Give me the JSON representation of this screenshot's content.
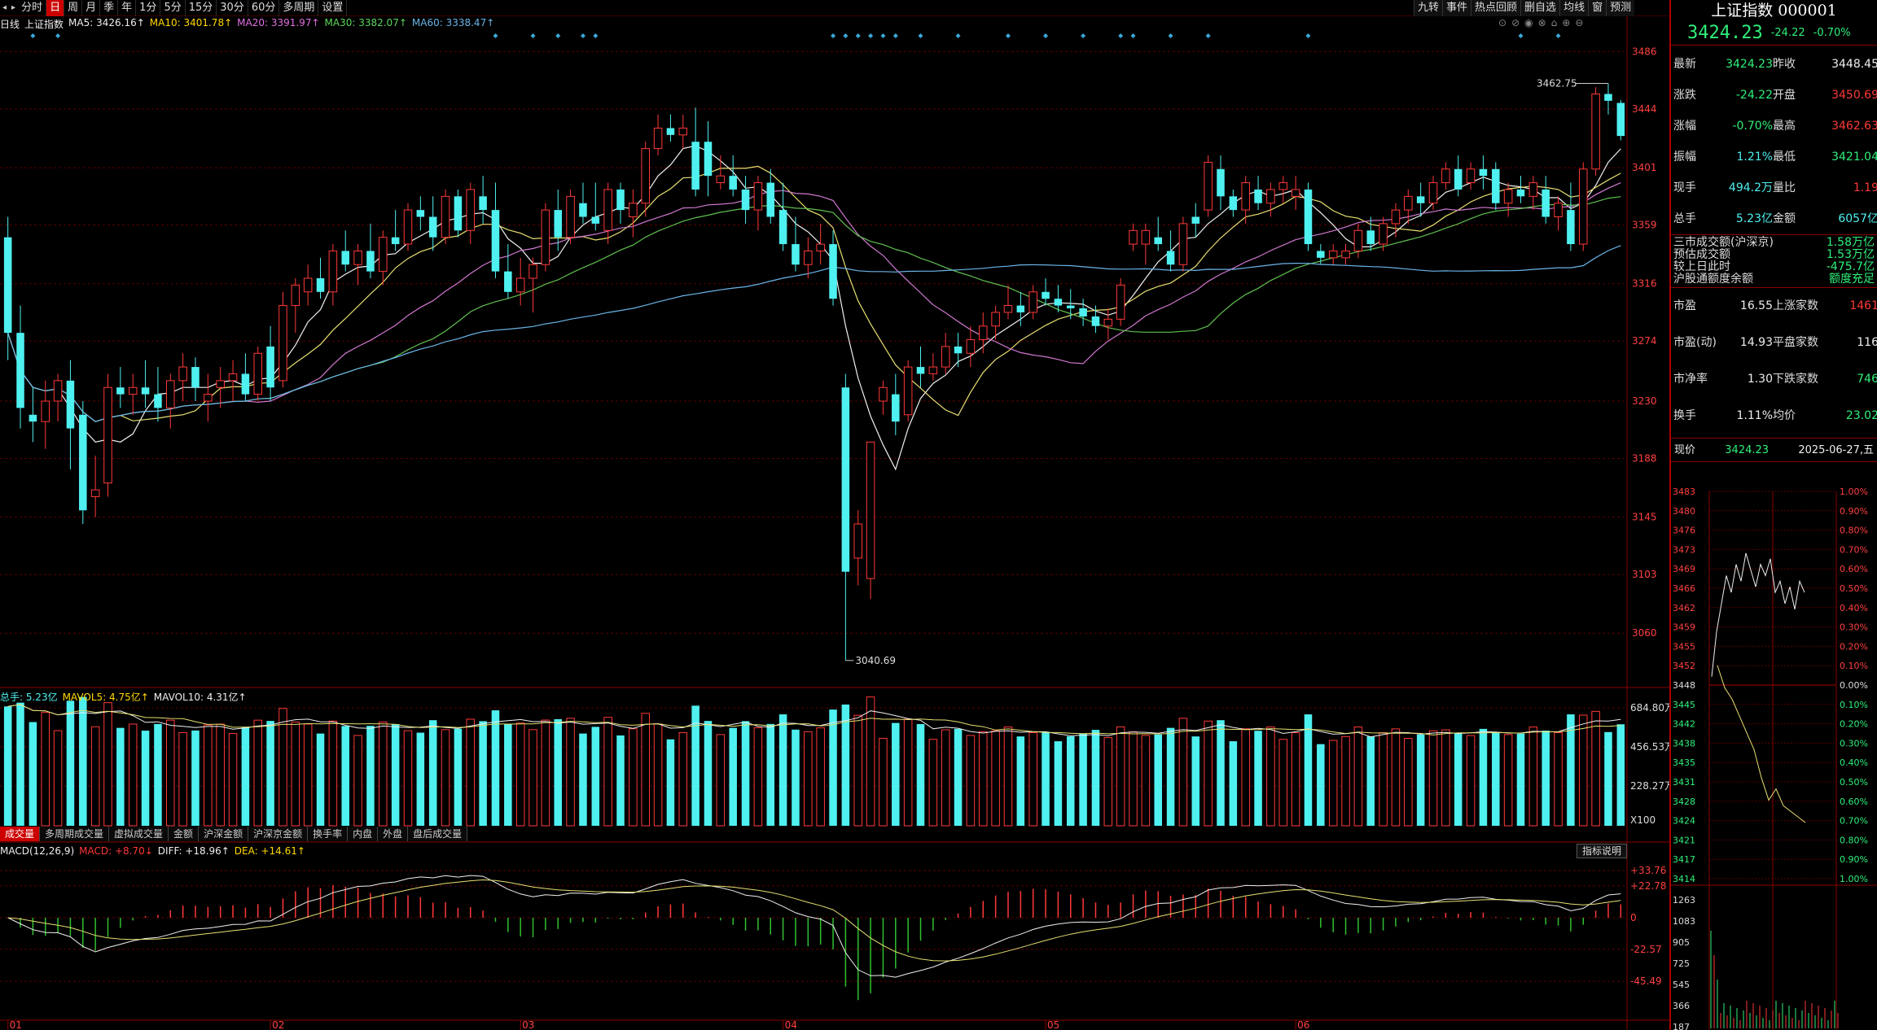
{
  "toolbar": {
    "arrow_left": "◂",
    "arrow_right": "▸",
    "periods": [
      "分时",
      "日",
      "周",
      "月",
      "季",
      "年",
      "1分",
      "5分",
      "15分",
      "30分",
      "60分",
      "多周期",
      "设置"
    ],
    "active_period": "日"
  },
  "right_toolbar": [
    "九转",
    "事件",
    "热点回顾",
    "删自选",
    "均线",
    "窗",
    "预测"
  ],
  "ma_bar": {
    "period": "日线",
    "name": "上证指数",
    "ma5": "MA5: 3426.16↑",
    "ma10": "MA10: 3401.78↑",
    "ma20": "MA20: 3391.97↑",
    "ma30": "MA30: 3382.07↑",
    "ma60": "MA60: 3338.47↑"
  },
  "chart_icons": [
    "⊙",
    "⊘",
    "◉",
    "⊗",
    "⌂",
    "⊕",
    "⊖"
  ],
  "chart_data": [
    {
      "type": "candlestick",
      "title": "上证指数",
      "y_ticks": [
        3486,
        3444,
        3401,
        3359,
        3316,
        3274,
        3230,
        3188,
        3145,
        3103,
        3060
      ],
      "ylim": [
        3022,
        3500
      ],
      "x_tick_labels": [
        "01",
        "02",
        "03",
        "04",
        "05",
        "06"
      ],
      "annotations": {
        "high": "3462.75",
        "low": "3040.69"
      },
      "ohlc": [
        [
          3350,
          3365,
          3260,
          3280
        ],
        [
          3280,
          3300,
          3210,
          3225
        ],
        [
          3220,
          3240,
          3200,
          3215
        ],
        [
          3215,
          3245,
          3195,
          3230
        ],
        [
          3230,
          3250,
          3215,
          3245
        ],
        [
          3245,
          3260,
          3180,
          3210
        ],
        [
          3220,
          3230,
          3140,
          3150
        ],
        [
          3160,
          3190,
          3145,
          3165
        ],
        [
          3170,
          3250,
          3160,
          3240
        ],
        [
          3240,
          3255,
          3225,
          3235
        ],
        [
          3235,
          3250,
          3220,
          3240
        ],
        [
          3240,
          3260,
          3225,
          3235
        ],
        [
          3235,
          3255,
          3215,
          3225
        ],
        [
          3225,
          3250,
          3210,
          3245
        ],
        [
          3245,
          3265,
          3230,
          3255
        ],
        [
          3255,
          3262,
          3230,
          3240
        ],
        [
          3230,
          3250,
          3215,
          3235
        ],
        [
          3240,
          3255,
          3225,
          3245
        ],
        [
          3245,
          3260,
          3230,
          3250
        ],
        [
          3250,
          3265,
          3230,
          3235
        ],
        [
          3235,
          3270,
          3230,
          3265
        ],
        [
          3270,
          3285,
          3230,
          3240
        ],
        [
          3245,
          3310,
          3240,
          3300
        ],
        [
          3300,
          3320,
          3280,
          3315
        ],
        [
          3310,
          3330,
          3300,
          3320
        ],
        [
          3320,
          3335,
          3305,
          3310
        ],
        [
          3310,
          3345,
          3300,
          3340
        ],
        [
          3340,
          3355,
          3325,
          3330
        ],
        [
          3330,
          3345,
          3315,
          3340
        ],
        [
          3340,
          3360,
          3320,
          3325
        ],
        [
          3325,
          3355,
          3315,
          3350
        ],
        [
          3350,
          3370,
          3340,
          3345
        ],
        [
          3345,
          3375,
          3340,
          3370
        ],
        [
          3370,
          3380,
          3355,
          3365
        ],
        [
          3365,
          3380,
          3340,
          3350
        ],
        [
          3350,
          3385,
          3345,
          3380
        ],
        [
          3380,
          3385,
          3350,
          3355
        ],
        [
          3355,
          3390,
          3345,
          3385
        ],
        [
          3380,
          3395,
          3360,
          3370
        ],
        [
          3370,
          3390,
          3320,
          3325
        ],
        [
          3325,
          3345,
          3305,
          3310
        ],
        [
          3310,
          3335,
          3300,
          3320
        ],
        [
          3320,
          3335,
          3295,
          3330
        ],
        [
          3330,
          3375,
          3325,
          3370
        ],
        [
          3370,
          3385,
          3340,
          3350
        ],
        [
          3350,
          3385,
          3345,
          3380
        ],
        [
          3375,
          3390,
          3360,
          3365
        ],
        [
          3365,
          3390,
          3355,
          3360
        ],
        [
          3355,
          3390,
          3345,
          3385
        ],
        [
          3385,
          3390,
          3360,
          3370
        ],
        [
          3365,
          3385,
          3350,
          3375
        ],
        [
          3375,
          3420,
          3365,
          3415
        ],
        [
          3415,
          3440,
          3410,
          3430
        ],
        [
          3430,
          3440,
          3420,
          3425
        ],
        [
          3425,
          3440,
          3415,
          3430
        ],
        [
          3420,
          3445,
          3380,
          3385
        ],
        [
          3420,
          3435,
          3380,
          3395
        ],
        [
          3390,
          3410,
          3385,
          3395
        ],
        [
          3395,
          3410,
          3380,
          3385
        ],
        [
          3385,
          3395,
          3360,
          3370
        ],
        [
          3370,
          3395,
          3355,
          3390
        ],
        [
          3390,
          3400,
          3360,
          3365
        ],
        [
          3370,
          3390,
          3340,
          3345
        ],
        [
          3345,
          3365,
          3325,
          3330
        ],
        [
          3330,
          3350,
          3320,
          3340
        ],
        [
          3340,
          3360,
          3330,
          3345
        ],
        [
          3345,
          3355,
          3300,
          3305
        ],
        [
          3240,
          3250,
          3040,
          3105
        ],
        [
          3115,
          3150,
          3095,
          3140
        ],
        [
          3100,
          3200,
          3085,
          3200
        ],
        [
          3230,
          3245,
          3220,
          3240
        ],
        [
          3235,
          3250,
          3205,
          3215
        ],
        [
          3220,
          3260,
          3215,
          3255
        ],
        [
          3255,
          3270,
          3240,
          3250
        ],
        [
          3250,
          3265,
          3245,
          3255
        ],
        [
          3255,
          3280,
          3250,
          3270
        ],
        [
          3270,
          3280,
          3255,
          3265
        ],
        [
          3265,
          3285,
          3255,
          3275
        ],
        [
          3275,
          3295,
          3265,
          3285
        ],
        [
          3285,
          3300,
          3275,
          3295
        ],
        [
          3295,
          3315,
          3290,
          3300
        ],
        [
          3300,
          3310,
          3285,
          3295
        ],
        [
          3295,
          3315,
          3290,
          3310
        ],
        [
          3310,
          3320,
          3300,
          3305
        ],
        [
          3305,
          3315,
          3295,
          3300
        ],
        [
          3300,
          3312,
          3290,
          3298
        ],
        [
          3298,
          3305,
          3285,
          3292
        ],
        [
          3292,
          3300,
          3280,
          3285
        ],
        [
          3285,
          3298,
          3275,
          3290
        ],
        [
          3290,
          3320,
          3285,
          3315
        ],
        [
          3345,
          3360,
          3340,
          3355
        ],
        [
          3345,
          3360,
          3330,
          3355
        ],
        [
          3350,
          3365,
          3340,
          3345
        ],
        [
          3340,
          3355,
          3325,
          3330
        ],
        [
          3330,
          3365,
          3325,
          3360
        ],
        [
          3365,
          3375,
          3350,
          3360
        ],
        [
          3370,
          3410,
          3365,
          3405
        ],
        [
          3400,
          3410,
          3370,
          3380
        ],
        [
          3380,
          3385,
          3365,
          3370
        ],
        [
          3370,
          3395,
          3360,
          3390
        ],
        [
          3385,
          3395,
          3370,
          3375
        ],
        [
          3375,
          3390,
          3365,
          3385
        ],
        [
          3385,
          3395,
          3375,
          3390
        ],
        [
          3380,
          3395,
          3370,
          3385
        ],
        [
          3385,
          3390,
          3340,
          3345
        ],
        [
          3340,
          3345,
          3330,
          3335
        ],
        [
          3335,
          3345,
          3330,
          3340
        ],
        [
          3335,
          3345,
          3330,
          3340
        ],
        [
          3340,
          3360,
          3335,
          3355
        ],
        [
          3355,
          3365,
          3340,
          3345
        ],
        [
          3345,
          3365,
          3340,
          3360
        ],
        [
          3360,
          3375,
          3350,
          3370
        ],
        [
          3370,
          3385,
          3360,
          3380
        ],
        [
          3380,
          3390,
          3365,
          3375
        ],
        [
          3375,
          3395,
          3370,
          3390
        ],
        [
          3390,
          3405,
          3385,
          3400
        ],
        [
          3400,
          3410,
          3380,
          3385
        ],
        [
          3390,
          3405,
          3385,
          3400
        ],
        [
          3400,
          3410,
          3385,
          3395
        ],
        [
          3400,
          3405,
          3370,
          3375
        ],
        [
          3375,
          3390,
          3365,
          3385
        ],
        [
          3385,
          3395,
          3375,
          3380
        ],
        [
          3380,
          3395,
          3370,
          3390
        ],
        [
          3385,
          3395,
          3360,
          3365
        ],
        [
          3365,
          3380,
          3355,
          3375
        ],
        [
          3370,
          3390,
          3340,
          3345
        ],
        [
          3345,
          3405,
          3340,
          3400
        ],
        [
          3400,
          3460,
          3395,
          3455
        ],
        [
          3455,
          3462.75,
          3440,
          3450
        ],
        [
          3448.45,
          3450.69,
          3421.04,
          3424.23
        ]
      ],
      "ma_series": [
        {
          "name": "MA5",
          "color": "#f0f0f0"
        },
        {
          "name": "MA10",
          "color": "#e8e070"
        },
        {
          "name": "MA20",
          "color": "#d078d0"
        },
        {
          "name": "MA30",
          "color": "#60c050"
        },
        {
          "name": "MA60",
          "color": "#6ab4e8"
        }
      ]
    },
    {
      "type": "bar",
      "title": "成交量",
      "y_ticks": [
        "684.80万",
        "456.53万",
        "228.27万",
        "X100"
      ]
    },
    {
      "type": "bar",
      "title": "MACD",
      "y_ticks": [
        "+33.76",
        "+22.78",
        "0",
        "-22.57",
        "-45.49"
      ]
    },
    {
      "type": "line",
      "title": "分时",
      "y_ticks_left": [
        "3483",
        "3480",
        "3476",
        "3473",
        "3469",
        "3466",
        "3462",
        "3459",
        "3455",
        "3452",
        "3448",
        "3445",
        "3442",
        "3438",
        "3435",
        "3431",
        "3428",
        "3424",
        "3421",
        "3417",
        "3414"
      ],
      "y_ticks_right": [
        "1.00%",
        "0.90%",
        "0.80%",
        "0.70%",
        "0.60%",
        "0.50%",
        "0.40%",
        "0.30%",
        "0.20%",
        "0.10%",
        "0.00%",
        "0.10%",
        "0.20%",
        "0.30%",
        "0.40%",
        "0.50%",
        "0.60%",
        "0.70%",
        "0.80%",
        "0.90%",
        "1.00%"
      ],
      "vol_ticks": [
        "1263",
        "1083",
        "905",
        "725",
        "545",
        "366",
        "187"
      ]
    }
  ],
  "volume_legend": {
    "total": "总手: 5.23亿",
    "mavol5": "MAVOL5: 4.75亿↑",
    "mavol10": "MAVOL10: 4.31亿↑"
  },
  "volume_tabs": [
    "成交量",
    "多周期成交量",
    "虚拟成交量",
    "金额",
    "沪深金额",
    "沪深京金额",
    "换手率",
    "内盘",
    "外盘",
    "盘后成交量"
  ],
  "macd_legend": {
    "label": "MACD(12,26,9)",
    "macd": "MACD: +8.70↓",
    "diff": "DIFF: +18.96↑",
    "dea": "DEA: +14.61↑"
  },
  "macd_help": "指标说明",
  "right_panel": {
    "title": "上证指数 000001",
    "price": "3424.23",
    "change": "-24.22",
    "change_pct": "-0.70%",
    "quote_rows": [
      {
        "l1": "最新",
        "v1": "3424.23",
        "c1": "g",
        "l2": "昨收",
        "v2": "3448.45",
        "c2": "w"
      },
      {
        "l1": "涨跌",
        "v1": "-24.22",
        "c1": "g",
        "l2": "开盘",
        "v2": "3450.69",
        "c2": "r"
      },
      {
        "l1": "涨幅",
        "v1": "-0.70%",
        "c1": "g",
        "l2": "最高",
        "v2": "3462.63",
        "c2": "r"
      },
      {
        "l1": "振幅",
        "v1": "1.21%",
        "c1": "c",
        "l2": "最低",
        "v2": "3421.04",
        "c2": "g"
      },
      {
        "l1": "现手",
        "v1": "494.2万",
        "c1": "c",
        "l2": "量比",
        "v2": "1.19",
        "c2": "r"
      },
      {
        "l1": "总手",
        "v1": "5.23亿",
        "c1": "c",
        "l2": "金额",
        "v2": "6057亿",
        "c2": "c"
      }
    ],
    "turnover_rows": [
      {
        "l": "三市成交额(沪深京)",
        "v": "1.58万亿"
      },
      {
        "l": "预估成交额",
        "v": "1.53万亿"
      },
      {
        "l": "较上日此时",
        "v": "-475.7亿"
      },
      {
        "l": "沪股通额度余额",
        "v": "额度充足"
      }
    ],
    "stat_rows": [
      {
        "l1": "市盈",
        "v1": "16.55",
        "l2": "上涨家数",
        "v2": "1461",
        "c2": "r"
      },
      {
        "l1": "市盈(动)",
        "v1": "14.93",
        "l2": "平盘家数",
        "v2": "116",
        "c2": "w"
      },
      {
        "l1": "市净率",
        "v1": "1.30",
        "l2": "下跌家数",
        "v2": "746",
        "c2": "g"
      },
      {
        "l1": "换手",
        "v1": "1.11%",
        "l2": "均价",
        "v2": "23.02",
        "c2": "g"
      }
    ],
    "current_label": "现价",
    "current_value": "3424.23",
    "current_date": "2025-06-27,五"
  }
}
